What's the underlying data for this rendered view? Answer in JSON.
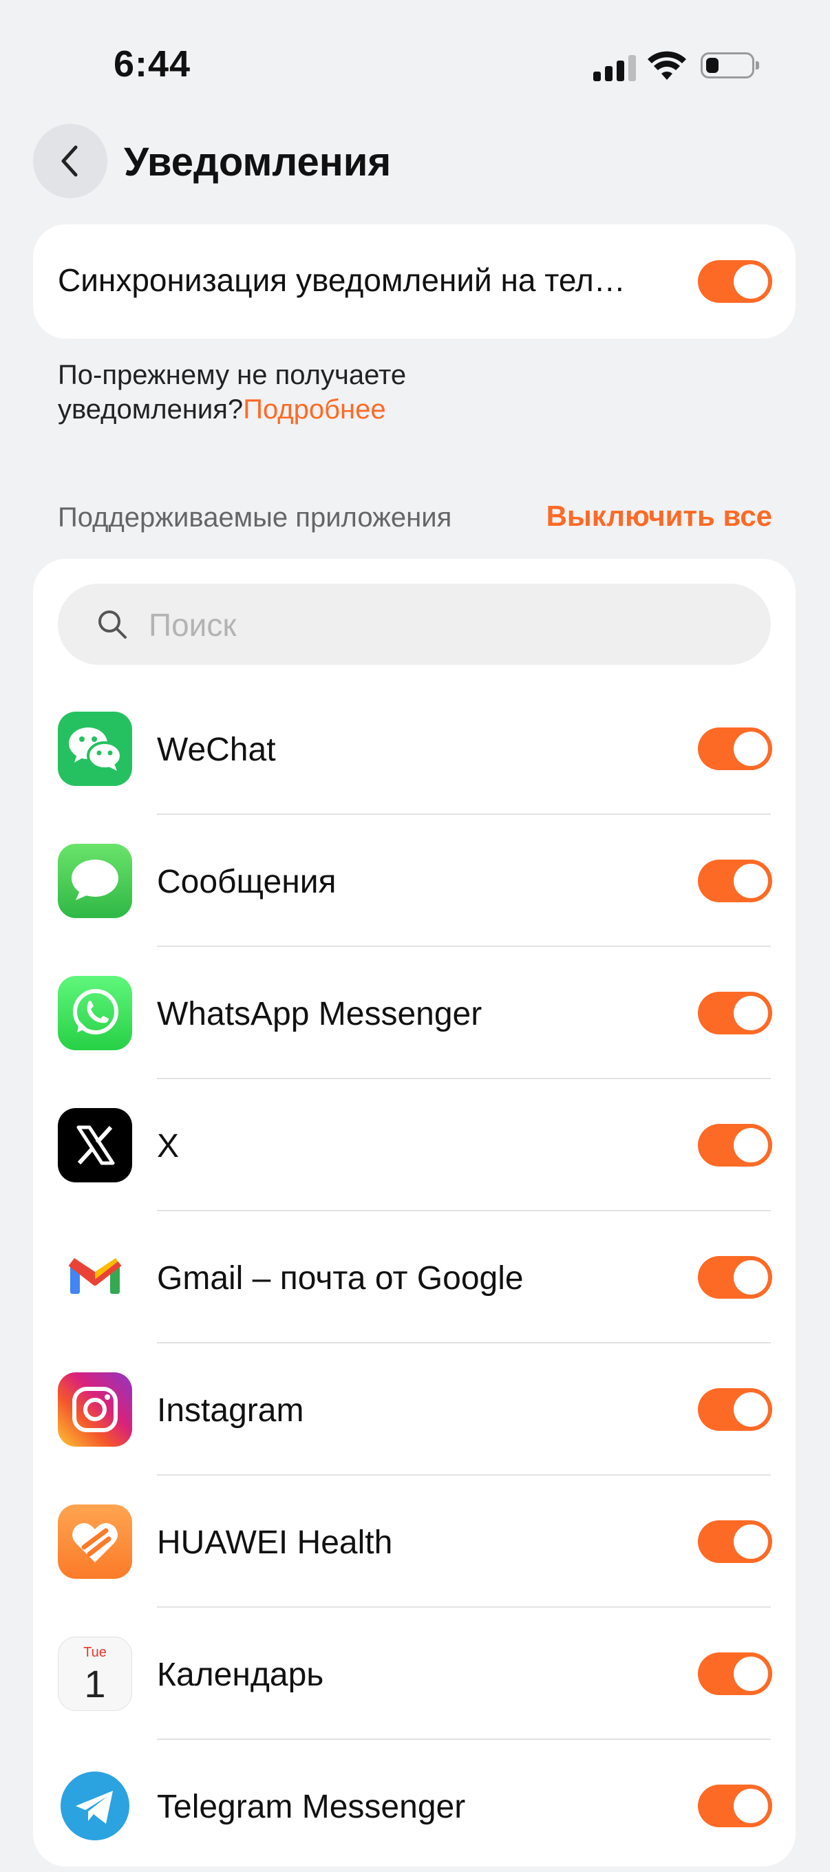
{
  "status_bar": {
    "time": "6:44"
  },
  "header": {
    "title": "Уведомления"
  },
  "sync": {
    "label": "Синхронизация уведомлений на тел…",
    "enabled": true
  },
  "help": {
    "text": "По-прежнему не получаете уведомления?",
    "link": "Подробнее"
  },
  "section": {
    "label": "Поддерживаемые приложения",
    "action": "Выключить все"
  },
  "search": {
    "placeholder": "Поиск",
    "value": ""
  },
  "apps": [
    {
      "name": "WeChat",
      "icon": "wechat-icon",
      "enabled": true
    },
    {
      "name": "Сообщения",
      "icon": "messages-icon",
      "enabled": true
    },
    {
      "name": "WhatsApp Messenger",
      "icon": "whatsapp-icon",
      "enabled": true
    },
    {
      "name": "X",
      "icon": "x-icon",
      "enabled": true
    },
    {
      "name": "Gmail – почта от Google",
      "icon": "gmail-icon",
      "enabled": true
    },
    {
      "name": "Instagram",
      "icon": "instagram-icon",
      "enabled": true
    },
    {
      "name": "HUAWEI Health",
      "icon": "huawei-health-icon",
      "enabled": true
    },
    {
      "name": "Календарь",
      "icon": "calendar-icon",
      "enabled": true,
      "icon_text": {
        "day": "Tue",
        "date": "1"
      }
    },
    {
      "name": "Telegram Messenger",
      "icon": "telegram-icon",
      "enabled": true
    }
  ],
  "colors": {
    "accent": "#fd6a25",
    "background": "#f1f2f4"
  }
}
